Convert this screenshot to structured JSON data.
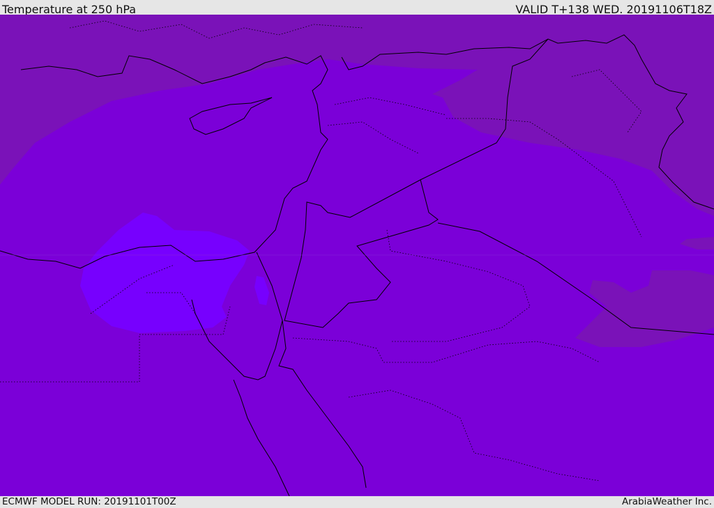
{
  "header": {
    "title": "Temperature at 250 hPa",
    "valid": "VALID T+138 WED. 20191106T18Z"
  },
  "footer": {
    "model_run": "ECMWF MODEL RUN: 20191101T00Z",
    "credit": "ArabiaWeather Inc."
  },
  "colors": {
    "base": "#7b00d8",
    "cooler": "#7a12b8",
    "warmer": "#7700fe",
    "border": "#000000"
  }
}
